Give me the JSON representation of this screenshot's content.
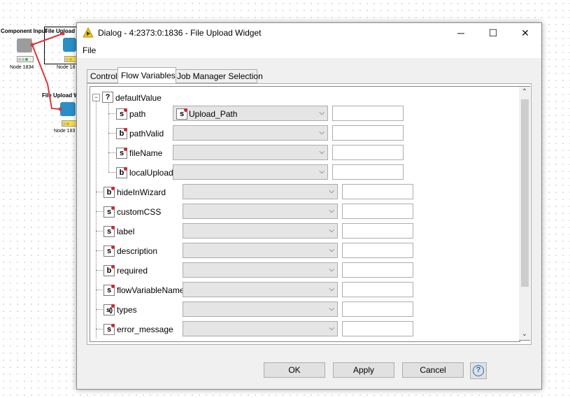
{
  "background": {
    "node1_title": "Component Input",
    "node1_label": "Node 1834",
    "node2_title": "File Upload W",
    "node2_label": "Node 18",
    "node3_title": "File Upload W",
    "node3_label": "Node 183"
  },
  "dialog": {
    "title": "Dialog - 4:2373:0:1836 - File Upload Widget",
    "menu_file": "File",
    "tabs": [
      "Control",
      "Flow Variables",
      "Job Manager Selection"
    ],
    "active_tab": "Flow Variables",
    "tree": {
      "root": {
        "type": "?",
        "label": "defaultValue"
      },
      "children": [
        {
          "type": "s",
          "label": "path",
          "selected": "Upload_Path",
          "selected_type": "s"
        },
        {
          "type": "b",
          "label": "pathValid",
          "selected": ""
        },
        {
          "type": "s",
          "label": "fileName",
          "selected": ""
        },
        {
          "type": "b",
          "label": "localUpload",
          "selected": ""
        }
      ],
      "items": [
        {
          "type": "b",
          "label": "hideInWizard"
        },
        {
          "type": "s",
          "label": "customCSS"
        },
        {
          "type": "s",
          "label": "label"
        },
        {
          "type": "s",
          "label": "description"
        },
        {
          "type": "b",
          "label": "required"
        },
        {
          "type": "s",
          "label": "flowVariableName"
        },
        {
          "type": "s()",
          "label": "types"
        },
        {
          "type": "s",
          "label": "error_message"
        }
      ]
    },
    "buttons": {
      "ok": "OK",
      "apply": "Apply",
      "cancel": "Cancel"
    },
    "window_controls": {
      "minimize": "─",
      "maximize": "☐",
      "close": "✕"
    },
    "accent_color": "#1c6fc3",
    "flow_var_dot_color": "#d6232b"
  }
}
